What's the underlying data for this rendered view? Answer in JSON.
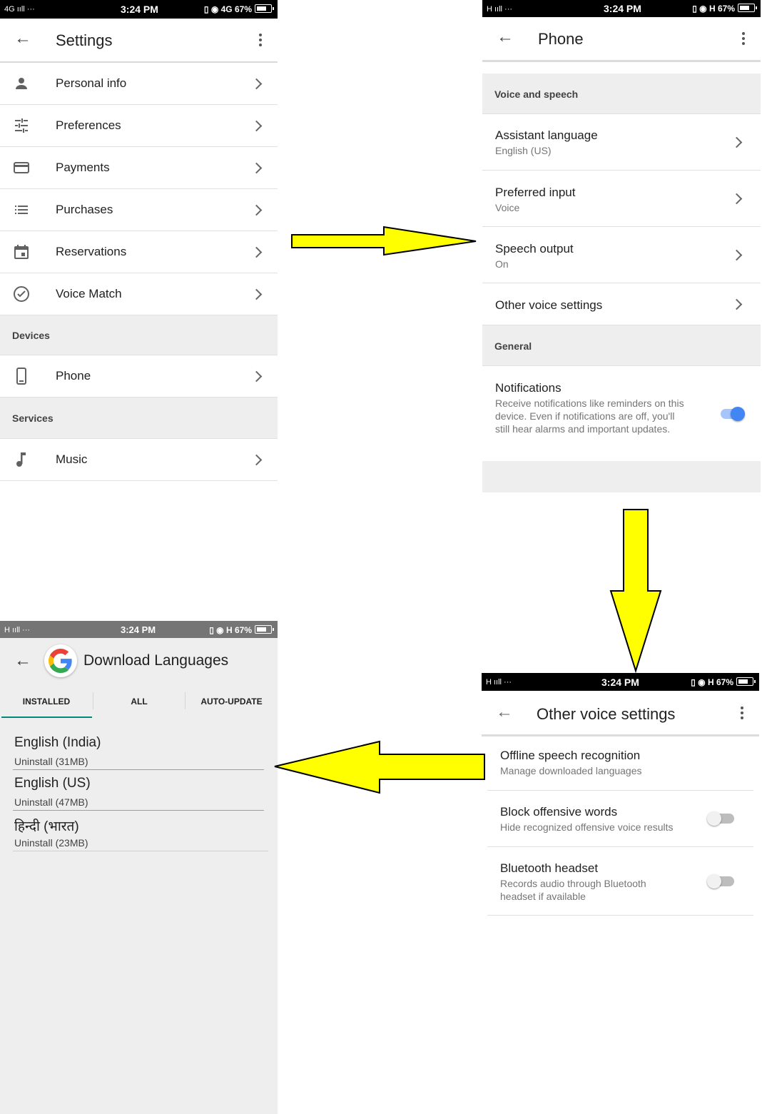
{
  "colors": {
    "accent": "#4285f4",
    "arrow": "#ffff00",
    "section_bg": "#eeeeee",
    "teal": "#00897b"
  },
  "settings": {
    "status": {
      "left": "4G ııll ···",
      "time": "3:24 PM",
      "right": "▯ ◉ 4G 67%"
    },
    "title": "Settings",
    "items": [
      {
        "label": "Personal info",
        "icon": "person-icon"
      },
      {
        "label": "Preferences",
        "icon": "tune-icon"
      },
      {
        "label": "Payments",
        "icon": "credit-card-icon"
      },
      {
        "label": "Purchases",
        "icon": "list-icon"
      },
      {
        "label": "Reservations",
        "icon": "calendar-icon"
      },
      {
        "label": "Voice Match",
        "icon": "voice-match-icon"
      }
    ],
    "devices_header": "Devices",
    "phone_label": "Phone",
    "services_header": "Services",
    "music_label": "Music"
  },
  "phone": {
    "status": {
      "left": "H ııll ···",
      "time": "3:24 PM",
      "right": "▯ ◉ H 67%"
    },
    "title": "Phone",
    "voice_header": "Voice and speech",
    "items": [
      {
        "title": "Assistant language",
        "sub": "English (US)"
      },
      {
        "title": "Preferred input",
        "sub": "Voice"
      },
      {
        "title": "Speech output",
        "sub": "On"
      }
    ],
    "other_voice": "Other voice settings",
    "general_header": "General",
    "notifications_title": "Notifications",
    "notifications_desc": "Receive notifications like reminders on this device. Even if notifications are off, you'll still hear alarms and important updates.",
    "notifications_on": true
  },
  "other": {
    "status": {
      "left": "H ııll ···",
      "time": "3:24 PM",
      "right": "▯ ◉ H 67%"
    },
    "title": "Other voice settings",
    "items": [
      {
        "title": "Offline speech recognition",
        "sub": "Manage downloaded languages"
      },
      {
        "title": "Block offensive words",
        "sub": "Hide recognized offensive voice results",
        "toggle": false
      },
      {
        "title": "Bluetooth headset",
        "sub": "Records audio through Bluetooth headset if available",
        "toggle": false
      }
    ]
  },
  "download": {
    "status": {
      "left": "H ııll ···",
      "time": "3:24 PM",
      "right": "▯ ◉ H 67%"
    },
    "title": "Download Languages",
    "tabs": [
      "INSTALLED",
      "ALL",
      "AUTO-UPDATE"
    ],
    "languages": [
      {
        "name": "English (India)",
        "action": "Uninstall (31MB)"
      },
      {
        "name": "English (US)",
        "action": "Uninstall (47MB)"
      },
      {
        "name": "हिन्दी (भारत)",
        "action": "Uninstall (23MB)"
      }
    ]
  }
}
